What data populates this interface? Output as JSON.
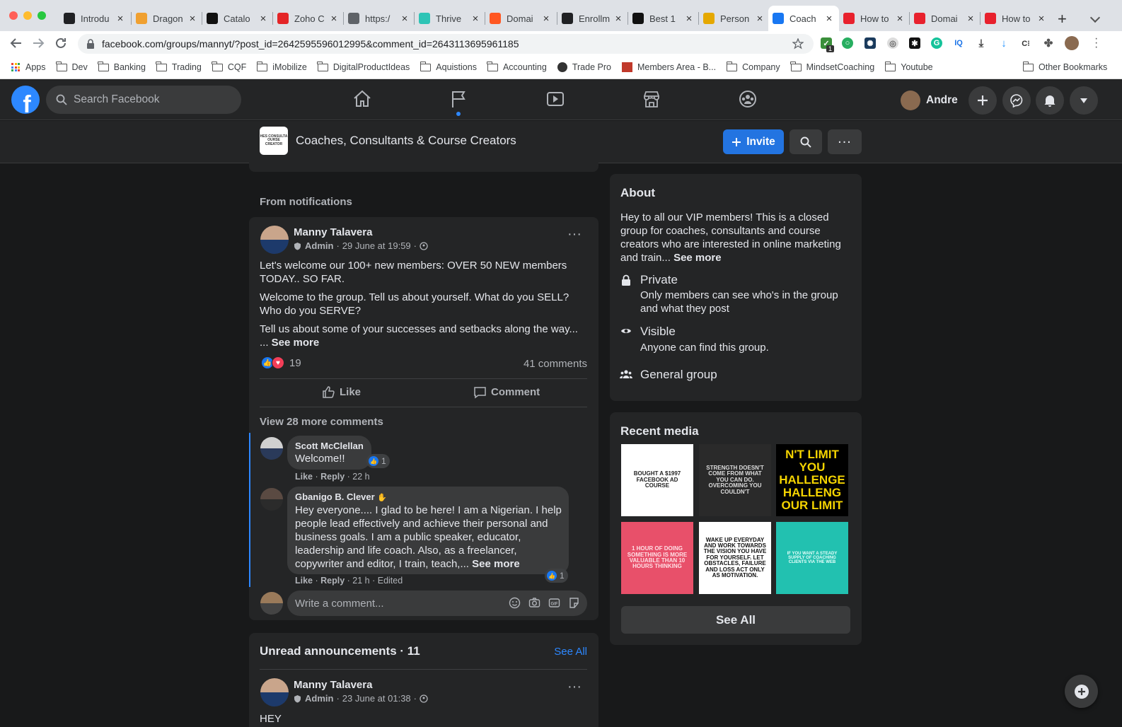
{
  "browser": {
    "tabs": [
      {
        "title": "Introdu",
        "icon": "terminal-icon",
        "color": "#202124"
      },
      {
        "title": "Dragon",
        "icon": "dragon-icon",
        "color": "#f0a030"
      },
      {
        "title": "Catalo",
        "icon": "fm-icon",
        "color": "#111111"
      },
      {
        "title": "Zoho C",
        "icon": "zoho-icon",
        "color": "#e42527"
      },
      {
        "title": "https:/",
        "icon": "globe-icon",
        "color": "#5f6368"
      },
      {
        "title": "Thrive",
        "icon": "thrive-icon",
        "color": "#2ec4b6"
      },
      {
        "title": "Domai",
        "icon": "domain-icon",
        "color": "#ff5722"
      },
      {
        "title": "Enrollm",
        "icon": "terminal-icon",
        "color": "#202124"
      },
      {
        "title": "Best 1",
        "icon": "best-icon",
        "color": "#111111"
      },
      {
        "title": "Person",
        "icon": "person-icon",
        "color": "#e5a800"
      },
      {
        "title": "Coach",
        "icon": "facebook-icon",
        "color": "#1877f2",
        "active": true
      },
      {
        "title": "How to",
        "icon": "z-icon",
        "color": "#e8212d"
      },
      {
        "title": "Domai",
        "icon": "z-icon",
        "color": "#e8212d"
      },
      {
        "title": "How to",
        "icon": "z-icon",
        "color": "#e8212d"
      }
    ],
    "url": "facebook.com/groups/mannyt/?post_id=2642595596012995&comment_id=2643113695961185",
    "bookmarks": [
      "Apps",
      "Dev",
      "Banking",
      "Trading",
      "CQF",
      "iMobilize",
      "DigitalProductIdeas",
      "Aquistions",
      "Accounting",
      "Trade Pro",
      "Members Area - B...",
      "Company",
      "MindsetCoaching",
      "Youtube"
    ],
    "other_bookmarks": "Other Bookmarks",
    "extension_badge": "1"
  },
  "fb": {
    "search_placeholder": "Search Facebook",
    "user_name": "Andre"
  },
  "group": {
    "name": "Coaches, Consultants & Course Creators",
    "logo_text": "HES CONSULTA\nOURSE CREATOR",
    "invite_label": "Invite"
  },
  "feed": {
    "section_label": "From notifications",
    "post": {
      "author": "Manny Talavera",
      "role": "Admin",
      "date": "29 June at 19:59",
      "para1": "Let's welcome our 100+ new members:  OVER 50 NEW members TODAY.. SO FAR.",
      "para2": "Welcome to the group. Tell us about yourself.  What do you SELL? Who do you SERVE?",
      "para3": "Tell us about some of your successes and setbacks along the way...",
      "para3_cont": "... ",
      "see_more": "See more",
      "reaction_count": "19",
      "comments_count": "41 comments",
      "like_label": "Like",
      "comment_label": "Comment",
      "view_more": "View 28 more comments"
    },
    "comments": [
      {
        "author": "Scott McClellan",
        "text": "Welcome!!",
        "likes": "1",
        "actions": [
          "Like",
          "Reply"
        ],
        "time": "22 h"
      },
      {
        "author": "Gbanigo B. Clever",
        "text": "Hey everyone.... I glad to be here! I am a Nigerian. I help people lead effectively and achieve their personal and business goals. I am a public speaker, educator, leadership and life coach. Also, as a freelancer, copywriter and editor, I train, teach,...",
        "see_more": "See more",
        "likes": "1",
        "actions": [
          "Like",
          "Reply"
        ],
        "time": "21 h",
        "edited": "Edited"
      }
    ],
    "comment_placeholder": "Write a comment...",
    "announcements": {
      "title": "Unread announcements · 11",
      "see_all": "See All",
      "post_author": "Manny Talavera",
      "post_role": "Admin",
      "post_date": "23 June at 01:38",
      "post_text": "HEY"
    }
  },
  "about": {
    "title": "About",
    "description": "Hey to all our VIP members! This is a closed group for coaches, consultants and course creators who are interested in online marketing and train...",
    "see_more": "See more",
    "private_title": "Private",
    "private_desc": "Only members can see who's in the group and what they post",
    "visible_title": "Visible",
    "visible_desc": "Anyone can find this group.",
    "general": "General group"
  },
  "recent_media": {
    "title": "Recent media",
    "tiles": [
      {
        "text": "BOUGHT A $1997 FACEBOOK AD COURSE",
        "bg": "#ffffff",
        "fg": "#222222"
      },
      {
        "text": "STRENGTH DOESN'T COME FROM WHAT YOU CAN DO. OVERCOMING YOU COULDN'T",
        "bg": "#2a2a2a",
        "fg": "#dddddd"
      },
      {
        "text": "N'T LIMIT YOU HALLENGE HALLENG OUR LIMIT",
        "bg": "#000000",
        "fg": "#f5d400"
      },
      {
        "text": "1 HOUR OF DOING SOMETHING IS MORE VALUABLE THAN 10 HOURS THINKING",
        "bg": "#e8506a",
        "fg": "#ffe0e6"
      },
      {
        "text": "WAKE UP EVERYDAY AND WORK TOWARDS THE VISION YOU HAVE FOR YOURSELF. LET OBSTACLES, FAILURE AND LOSS ACT ONLY AS MOTIVATION.",
        "bg": "#ffffff",
        "fg": "#111111"
      },
      {
        "text": "IF YOU WANT A STEADY SUPPLY OF COACHING CLIENTS VIA THE WEB",
        "bg": "#22c1b0",
        "fg": "#e8fffb"
      }
    ],
    "see_all": "See All"
  }
}
